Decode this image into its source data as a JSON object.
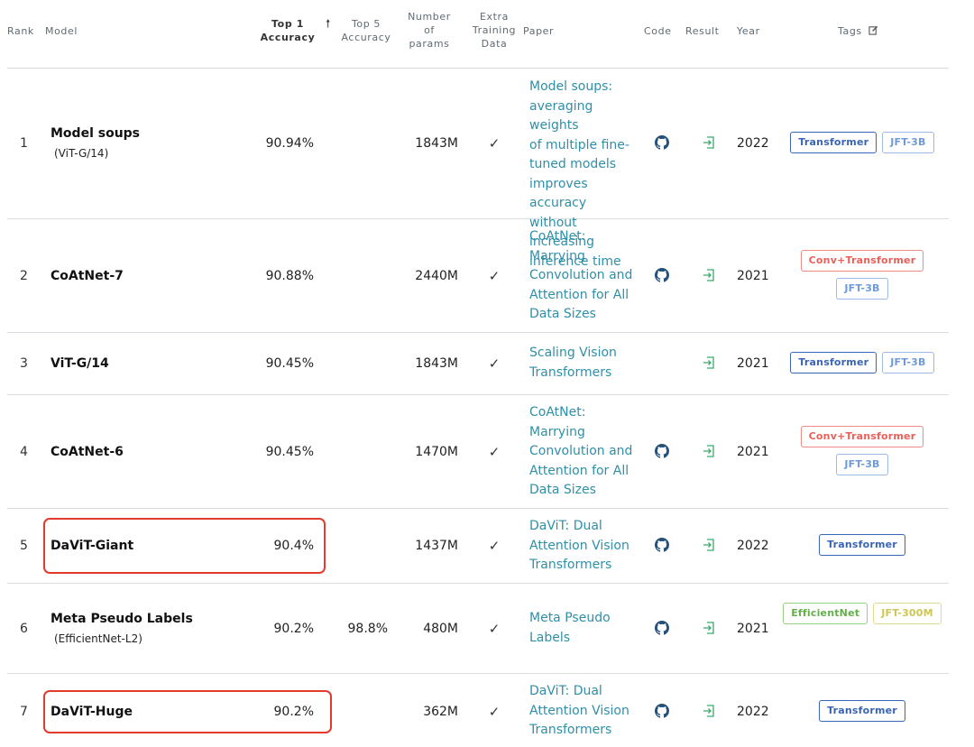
{
  "headers": {
    "rank": "Rank",
    "model": "Model",
    "top1": [
      "Top 1",
      "Accuracy"
    ],
    "sort_arrow": "🠕",
    "top5": [
      "Top 5",
      "Accuracy"
    ],
    "params": [
      "Number",
      "of",
      "params"
    ],
    "extra": [
      "Extra",
      "Training",
      "Data"
    ],
    "paper": "Paper",
    "code": "Code",
    "result": "Result",
    "year": "Year",
    "tags": "Tags",
    "edit_icon": "edit-icon"
  },
  "rows": [
    {
      "rank": "1",
      "model": "Model soups",
      "variant": "(ViT-G/14)",
      "top1": "90.94%",
      "top5": "",
      "params": "1843M",
      "extra": "✓",
      "paper": [
        "Model soups:",
        "averaging weights",
        "of multiple fine-",
        "tuned models",
        "improves accuracy",
        "without increasing",
        "inference time"
      ],
      "code": true,
      "year": "2022",
      "tags": [
        {
          "label": "Transformer",
          "color": "blue"
        },
        {
          "label": "JFT-3B",
          "color": "lightblue"
        }
      ]
    },
    {
      "rank": "2",
      "model": "CoAtNet-7",
      "variant": "",
      "top1": "90.88%",
      "top5": "",
      "params": "2440M",
      "extra": "✓",
      "paper": [
        "CoAtNet:",
        "Marrying",
        "Convolution and",
        "Attention for All",
        "Data Sizes"
      ],
      "code": true,
      "year": "2021",
      "tags": [
        {
          "label": "Conv+Transformer",
          "color": "red"
        },
        {
          "label": "JFT-3B",
          "color": "lightblue"
        }
      ]
    },
    {
      "rank": "3",
      "model": "ViT-G/14",
      "variant": "",
      "top1": "90.45%",
      "top5": "",
      "params": "1843M",
      "extra": "✓",
      "paper": [
        "Scaling Vision",
        "Transformers"
      ],
      "code": false,
      "year": "2021",
      "tags": [
        {
          "label": "Transformer",
          "color": "blue"
        },
        {
          "label": "JFT-3B",
          "color": "lightblue"
        }
      ]
    },
    {
      "rank": "4",
      "model": "CoAtNet-6",
      "variant": "",
      "top1": "90.45%",
      "top5": "",
      "params": "1470M",
      "extra": "✓",
      "paper": [
        "CoAtNet:",
        "Marrying",
        "Convolution and",
        "Attention for All",
        "Data Sizes"
      ],
      "code": true,
      "year": "2021",
      "tags": [
        {
          "label": "Conv+Transformer",
          "color": "red"
        },
        {
          "label": "JFT-3B",
          "color": "lightblue"
        }
      ]
    },
    {
      "rank": "5",
      "model": "DaViT-Giant",
      "variant": "",
      "top1": "90.4%",
      "top5": "",
      "params": "1437M",
      "extra": "✓",
      "paper": [
        "DaViT: Dual",
        "Attention Vision",
        "Transformers"
      ],
      "code": true,
      "year": "2022",
      "tags": [
        {
          "label": "Transformer",
          "color": "blue"
        }
      ]
    },
    {
      "rank": "6",
      "model": "Meta Pseudo Labels",
      "variant": "(EfficientNet-L2)",
      "top1": "90.2%",
      "top5": "98.8%",
      "params": "480M",
      "extra": "✓",
      "paper": [
        "Meta Pseudo",
        "Labels"
      ],
      "code": true,
      "year": "2021",
      "tags": [
        {
          "label": "EfficientNet",
          "color": "green"
        },
        {
          "label": "JFT-300M",
          "color": "yellow"
        }
      ]
    },
    {
      "rank": "7",
      "model": "DaViT-Huge",
      "variant": "",
      "top1": "90.2%",
      "top5": "",
      "params": "362M",
      "extra": "✓",
      "paper": [
        "DaViT: Dual",
        "Attention Vision",
        "Transformers"
      ],
      "code": true,
      "year": "2022",
      "tags": [
        {
          "label": "Transformer",
          "color": "blue"
        }
      ]
    }
  ],
  "highlight_color": "#e23a2c",
  "icons": {
    "code": "github-icon",
    "result": "result-link-icon",
    "extra": "checkmark-icon"
  }
}
